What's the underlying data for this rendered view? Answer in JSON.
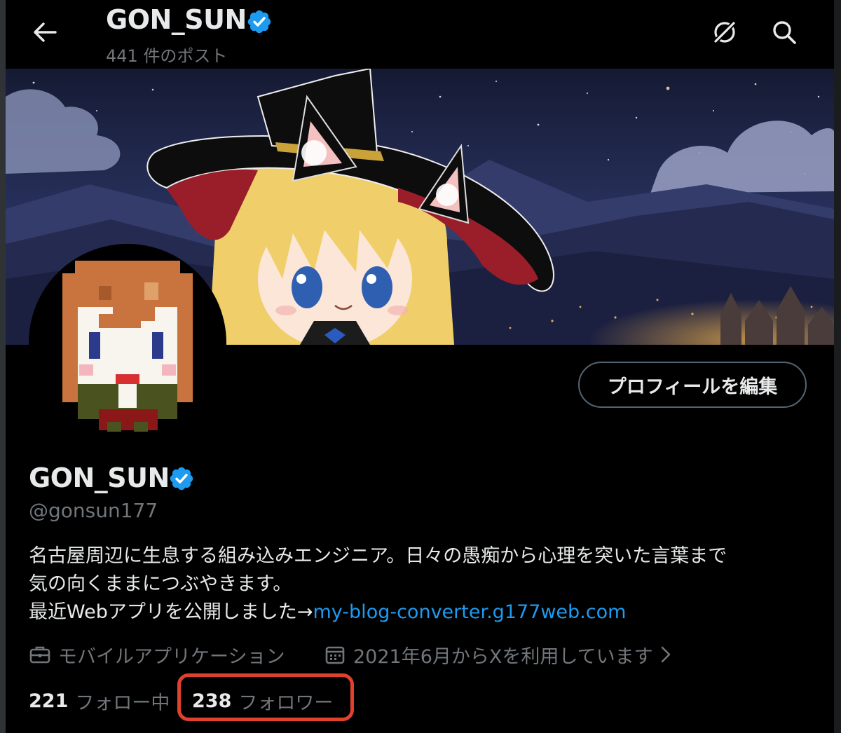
{
  "header": {
    "name": "GON_SUN",
    "posts_count": "441 件のポスト"
  },
  "profile": {
    "display_name": "GON_SUN",
    "handle": "@gonsun177",
    "edit_button": "プロフィールを編集",
    "bio": {
      "line1": "名古屋周辺に生息する組み込みエンジニア。日々の愚痴から心理を突いた言葉まで",
      "line2": "気の向くままにつぶやきます。",
      "line3_prefix": "最近Webアプリを公開しました→",
      "link": "my-blog-converter.g177web.com"
    },
    "category": "モバイルアプリケーション",
    "joined": "2021年6月からXを利用しています",
    "following_count": "221",
    "following_label": "フォロー中",
    "followers_count": "238",
    "followers_label": "フォロワー"
  },
  "colors": {
    "background": "#000000",
    "text": "#e7e9ea",
    "muted": "#71767b",
    "link": "#1d9bf0",
    "verified": "#1d9bf0",
    "highlight": "#e0412c"
  },
  "icons": [
    "back-arrow-icon",
    "grok-icon",
    "search-icon",
    "verified-badge-icon",
    "briefcase-icon",
    "calendar-icon",
    "chevron-right-icon"
  ]
}
